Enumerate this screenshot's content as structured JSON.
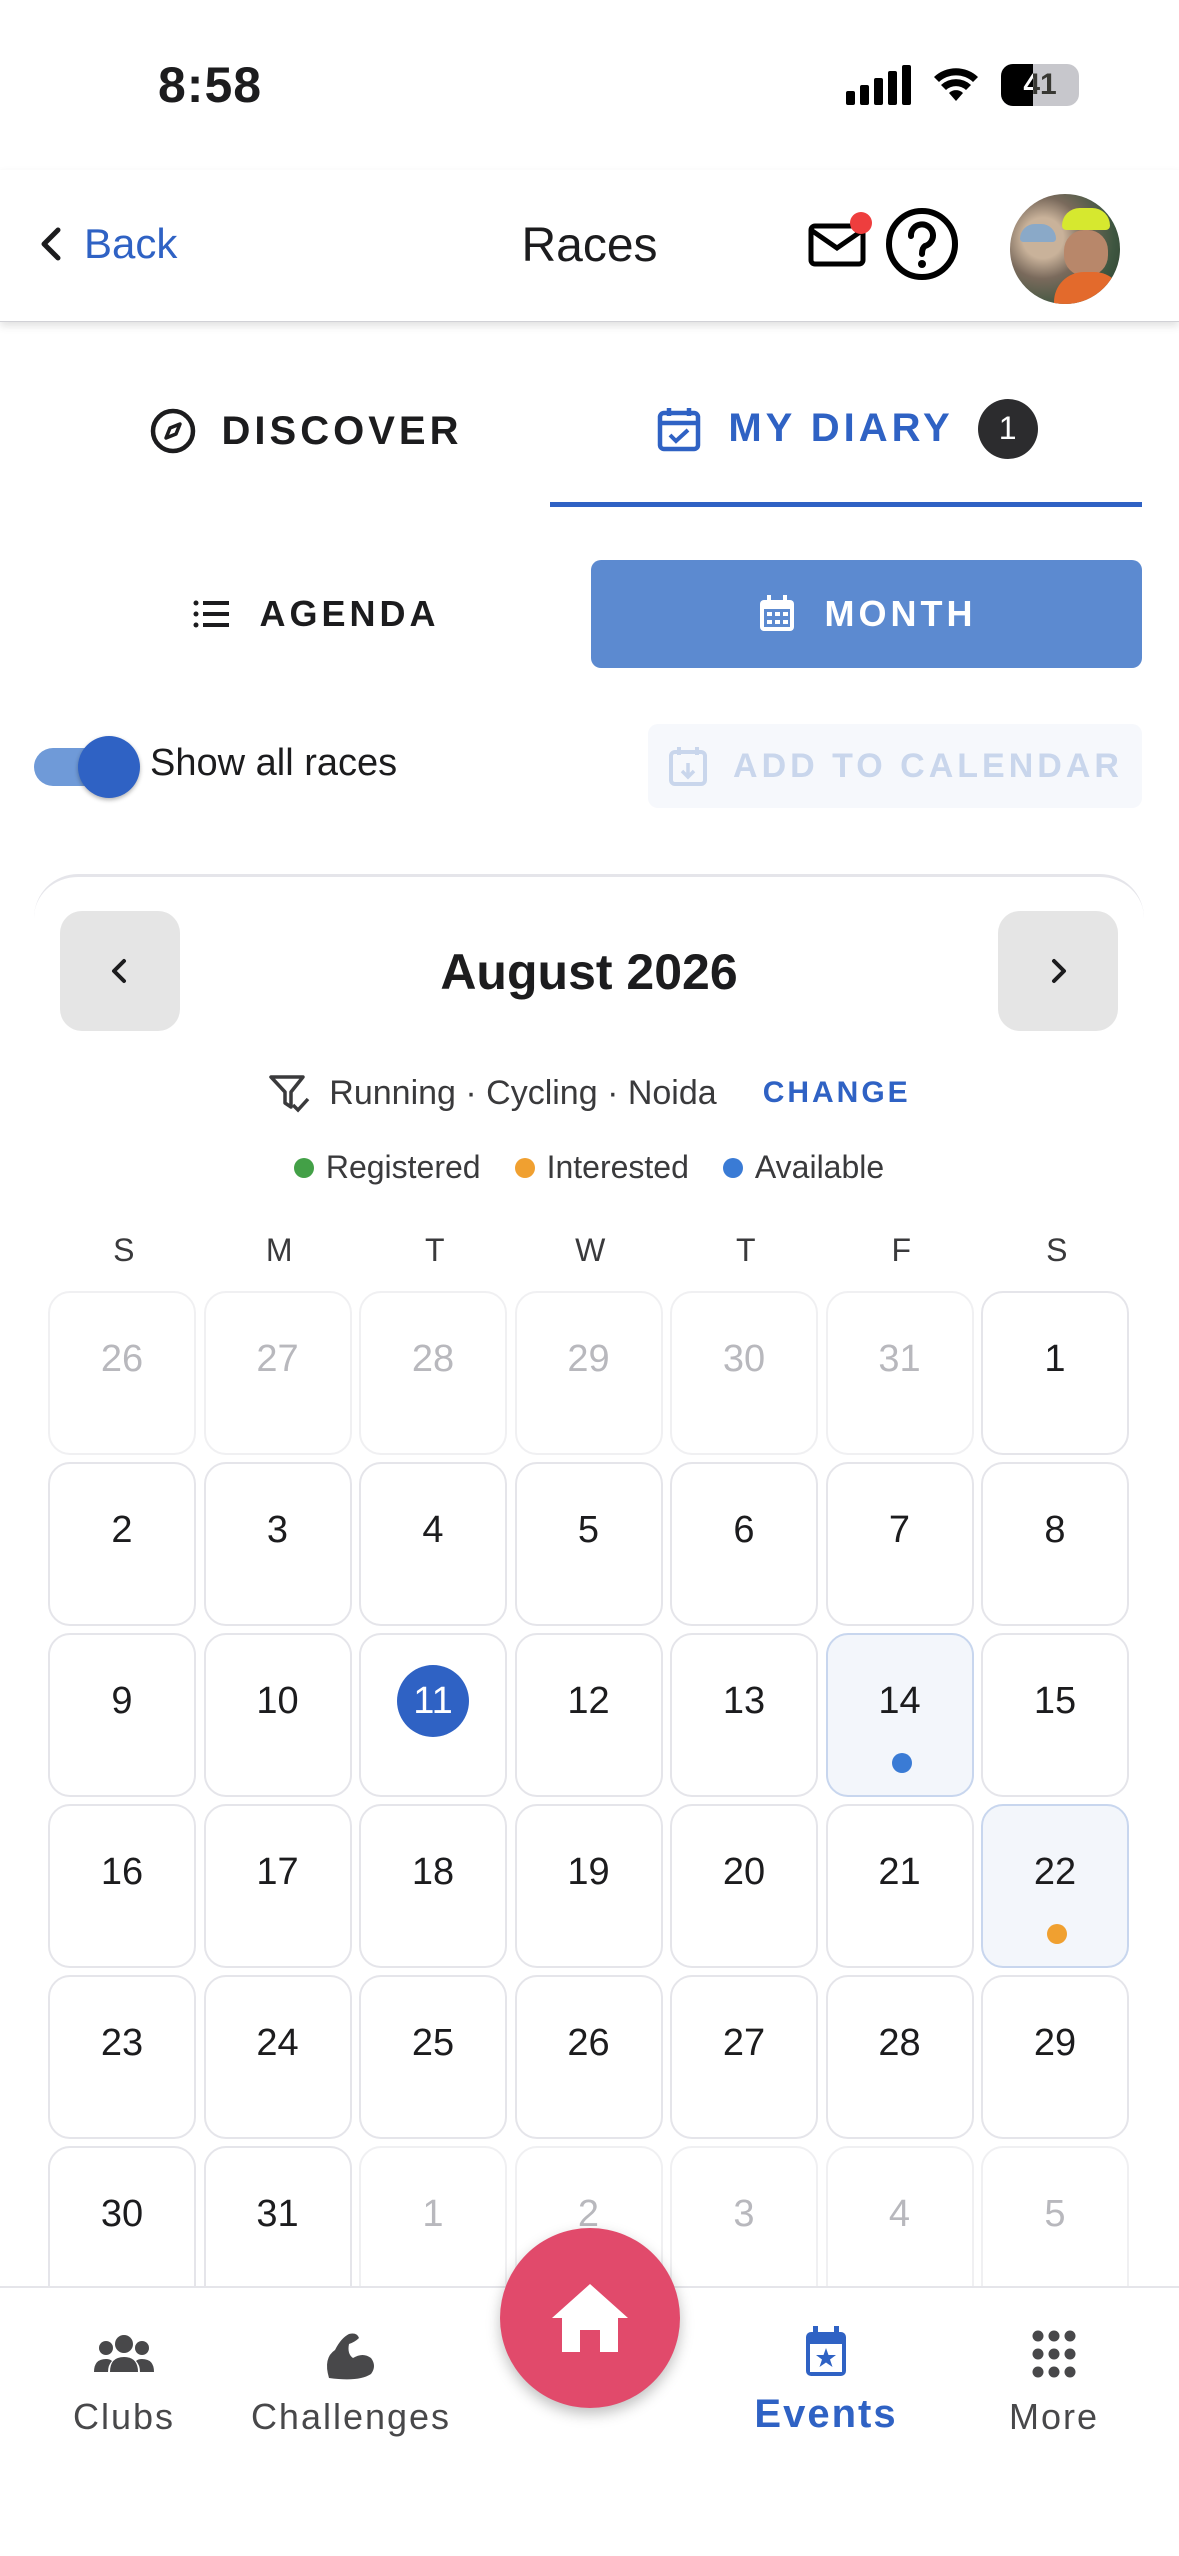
{
  "status_bar": {
    "time": "8:58",
    "battery": "41",
    "battery_level": 0.41
  },
  "header": {
    "back_label": "Back",
    "title": "Races"
  },
  "tabs": {
    "discover": "DISCOVER",
    "diary": "MY DIARY",
    "diary_count": "1"
  },
  "view_toggle": {
    "agenda": "AGENDA",
    "month": "MONTH",
    "selected": "MONTH"
  },
  "options": {
    "show_all_label": "Show all races",
    "show_all_on": true,
    "add_to_calendar": "ADD TO CALENDAR"
  },
  "calendar": {
    "month_title": "August 2026",
    "filter_text": "Running · Cycling · Noida",
    "change_label": "CHANGE",
    "legend": [
      {
        "label": "Registered",
        "color": "#43a047"
      },
      {
        "label": "Interested",
        "color": "#f0a030"
      },
      {
        "label": "Available",
        "color": "#3a7bd5"
      }
    ],
    "weekdays": [
      "S",
      "M",
      "T",
      "W",
      "T",
      "F",
      "S"
    ],
    "weeks": [
      [
        {
          "d": "26",
          "other": true
        },
        {
          "d": "27",
          "other": true
        },
        {
          "d": "28",
          "other": true
        },
        {
          "d": "29",
          "other": true
        },
        {
          "d": "30",
          "other": true
        },
        {
          "d": "31",
          "other": true
        },
        {
          "d": "1"
        }
      ],
      [
        {
          "d": "2"
        },
        {
          "d": "3"
        },
        {
          "d": "4"
        },
        {
          "d": "5"
        },
        {
          "d": "6"
        },
        {
          "d": "7"
        },
        {
          "d": "8"
        }
      ],
      [
        {
          "d": "9"
        },
        {
          "d": "10"
        },
        {
          "d": "11",
          "today": true
        },
        {
          "d": "12"
        },
        {
          "d": "13"
        },
        {
          "d": "14",
          "dot": "#3a7bd5",
          "highlight": true
        },
        {
          "d": "15"
        }
      ],
      [
        {
          "d": "16"
        },
        {
          "d": "17"
        },
        {
          "d": "18"
        },
        {
          "d": "19"
        },
        {
          "d": "20"
        },
        {
          "d": "21"
        },
        {
          "d": "22",
          "dot": "#f0a030",
          "highlight": true
        }
      ],
      [
        {
          "d": "23"
        },
        {
          "d": "24"
        },
        {
          "d": "25"
        },
        {
          "d": "26"
        },
        {
          "d": "27"
        },
        {
          "d": "28"
        },
        {
          "d": "29"
        }
      ],
      [
        {
          "d": "30"
        },
        {
          "d": "31"
        },
        {
          "d": "1",
          "other": true
        },
        {
          "d": "2",
          "other": true
        },
        {
          "d": "3",
          "other": true
        },
        {
          "d": "4",
          "other": true
        },
        {
          "d": "5",
          "other": true
        }
      ]
    ]
  },
  "bottom_nav": {
    "clubs": "Clubs",
    "challenges": "Challenges",
    "events": "Events",
    "more": "More"
  },
  "colors": {
    "accent": "#2f62c4",
    "home_fab": "#e14a6b"
  }
}
